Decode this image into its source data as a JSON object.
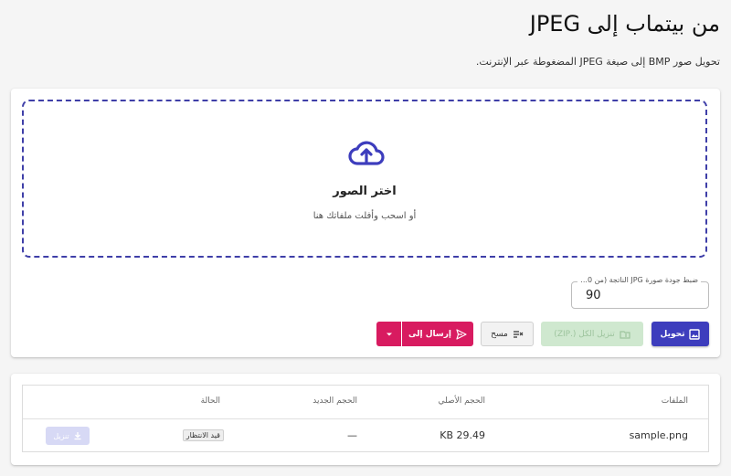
{
  "page": {
    "title": "من بيتماب إلى JPEG",
    "subtitle": "تحويل صور BMP إلى صيغة JPEG المضغوطة عبر الإنترنت."
  },
  "dropzone": {
    "icon": "cloud-upload-icon",
    "title": "اختر الصور",
    "hint": "أو اسحب وأفلت ملفاتك هنا"
  },
  "quality": {
    "label": "ضبط جودة صورة JPG الناتجة (من 0...",
    "value": "90"
  },
  "actions": {
    "convert_label": "تحويل",
    "zip_label": "تنزيل الكل (.ZIP)",
    "clear_label": "مسح",
    "send_label": "إرسال إلى"
  },
  "table": {
    "headers": {
      "files": "الملفات",
      "original_size": "الحجم الأصلي",
      "new_size": "الحجم الجديد",
      "status": "الحالة"
    },
    "rows": [
      {
        "file": "sample.png",
        "original_size": "29.49 KB",
        "new_size": "—",
        "status": "قيد الانتظار",
        "download_label": "تنزيل"
      }
    ]
  },
  "colors": {
    "primary": "#3d3dbd",
    "accent": "#d81b60",
    "disabled_green": "#cfe8cf",
    "dropzone_border": "#3f3fa8"
  }
}
